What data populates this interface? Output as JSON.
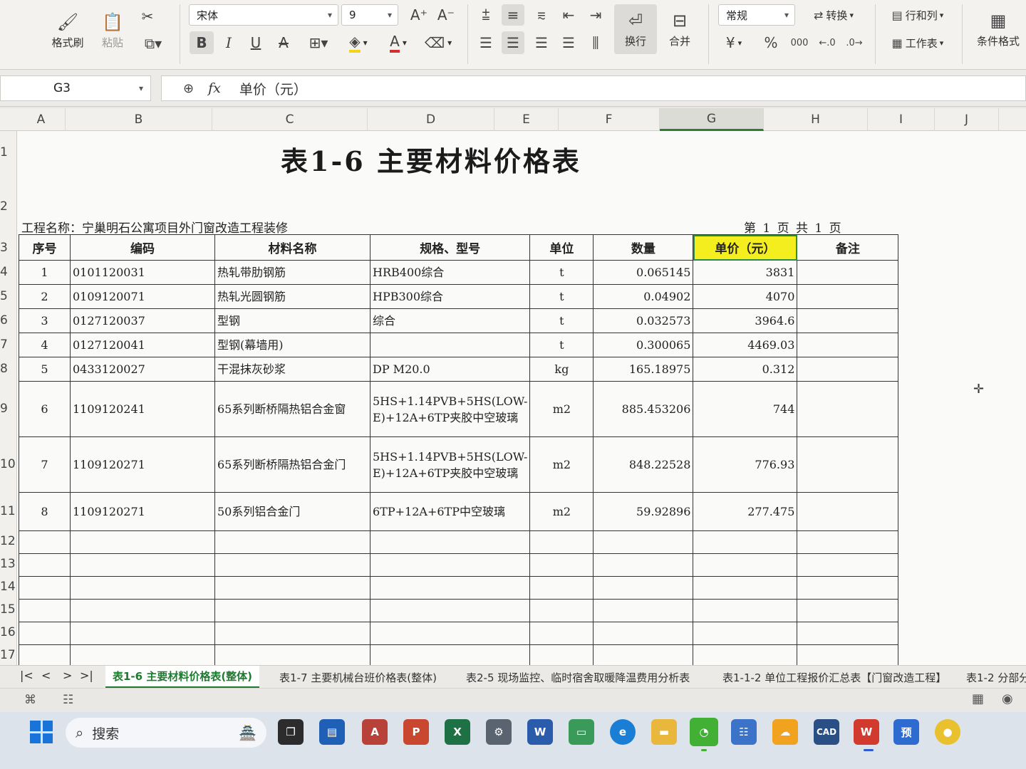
{
  "ribbon": {
    "format_painter": "格式刷",
    "paste": "粘贴",
    "font_name": "宋体",
    "font_size": "9",
    "wrap": "换行",
    "merge": "合并",
    "number_format": "常规",
    "convert": "转换",
    "rows_cols": "行和列",
    "worksheet": "工作表",
    "conditional_format": "条件格式",
    "currency_symbol": "¥",
    "percent_symbol": "%",
    "thousands_symbol": "000"
  },
  "formula_bar": {
    "cell_ref": "G3",
    "fx": "fx",
    "value": "单价（元）"
  },
  "columns": [
    "A",
    "B",
    "C",
    "D",
    "E",
    "F",
    "G",
    "H",
    "I",
    "J"
  ],
  "rows": [
    "1",
    "2",
    "3",
    "4",
    "5",
    "6",
    "7",
    "8",
    "9",
    "10",
    "11",
    "12",
    "13",
    "14",
    "15",
    "16",
    "17"
  ],
  "sheet": {
    "title": "表1-6  主要材料价格表",
    "project_line": "工程名称：宁巢明石公寓项目外门窗改造工程装修",
    "page_info": "第 1 页   共 1 页",
    "headers": [
      "序号",
      "编码",
      "材料名称",
      "规格、型号",
      "单位",
      "数量",
      "单价（元）",
      "备注"
    ],
    "rows": [
      {
        "no": "1",
        "code": "0101120031",
        "name": "热轧带肋钢筋",
        "spec": "HRB400综合",
        "unit": "t",
        "qty": "0.065145",
        "price": "3831",
        "note": ""
      },
      {
        "no": "2",
        "code": "0109120071",
        "name": "热轧光圆钢筋",
        "spec": "HPB300综合",
        "unit": "t",
        "qty": "0.04902",
        "price": "4070",
        "note": ""
      },
      {
        "no": "3",
        "code": "0127120037",
        "name": "型钢",
        "spec": "综合",
        "unit": "t",
        "qty": "0.032573",
        "price": "3964.6",
        "note": ""
      },
      {
        "no": "4",
        "code": "0127120041",
        "name": "型钢(幕墙用)",
        "spec": "",
        "unit": "t",
        "qty": "0.300065",
        "price": "4469.03",
        "note": ""
      },
      {
        "no": "5",
        "code": "0433120027",
        "name": "干混抹灰砂浆",
        "spec": "DP M20.0",
        "unit": "kg",
        "qty": "165.18975",
        "price": "0.312",
        "note": ""
      },
      {
        "no": "6",
        "code": "1109120241",
        "name": "65系列断桥隔热铝合金窗",
        "spec": "5HS+1.14PVB+5HS(LOW-E)+12A+6TP夹胶中空玻璃",
        "unit": "m2",
        "qty": "885.453206",
        "price": "744",
        "note": ""
      },
      {
        "no": "7",
        "code": "1109120271",
        "name": "65系列断桥隔热铝合金门",
        "spec": "5HS+1.14PVB+5HS(LOW-E)+12A+6TP夹胶中空玻璃",
        "unit": "m2",
        "qty": "848.22528",
        "price": "776.93",
        "note": ""
      },
      {
        "no": "8",
        "code": "1109120271",
        "name": "50系列铝合金门",
        "spec": "6TP+12A+6TP中空玻璃",
        "unit": "m2",
        "qty": "59.92896",
        "price": "277.475",
        "note": ""
      }
    ]
  },
  "tabs": [
    "表1-6 主要材料价格表(整体)",
    "表1-7 主要机械台班价格表(整体)",
    "表2-5 现场监控、临时宿舍取暖降温费用分析表",
    "表1-1-2 单位工程报价汇总表【门窗改造工程】",
    "表1-2 分部分"
  ],
  "taskbar": {
    "search_label": "搜索",
    "apps": [
      "A",
      "P",
      "X",
      "W",
      "预",
      "CAD"
    ]
  },
  "colors": {
    "selected_header_fill": "#f5ee1f",
    "selection_border": "#2e8b3e",
    "active_tab": "#1e7a2e"
  }
}
